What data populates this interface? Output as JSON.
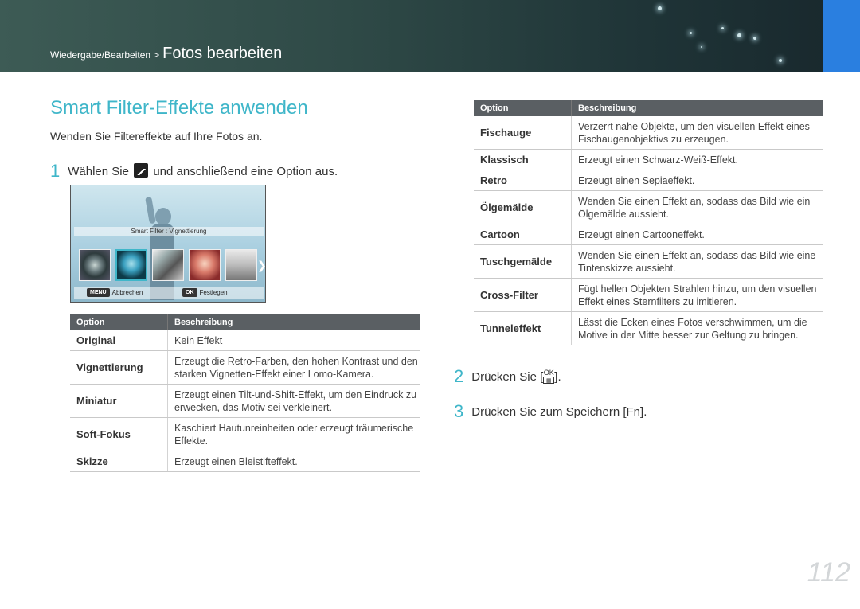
{
  "header": {
    "breadcrumb_parent": "Wiedergabe/Bearbeiten",
    "breadcrumb_separator": ">",
    "breadcrumb_current": "Fotos bearbeiten",
    "accent_color": "#3fb6c9",
    "tab_color": "#2a7fe0"
  },
  "section": {
    "title": "Smart Filter-Effekte anwenden",
    "intro": "Wenden Sie Filtereffekte auf Ihre Fotos an."
  },
  "steps": {
    "step1_num": "1",
    "step1_pre": "Wählen Sie",
    "step1_icon": "photo-filter-icon",
    "step1_post": "und anschließend eine Option aus.",
    "step2_num": "2",
    "step2_text": "Drücken Sie [",
    "step2_key_top": "OK",
    "step2_key_bottom": "",
    "step2_end": "].",
    "step3_num": "3",
    "step3_text": "Drücken Sie zum Speichern [",
    "step3_key": "Fn",
    "step3_end": "]."
  },
  "camera_screen": {
    "filter_label": "Smart Filter : Vignettierung",
    "menu_key": "MENU",
    "cancel_label": "Abbrechen",
    "ok_key": "OK",
    "confirm_label": "Festlegen"
  },
  "table_header": {
    "option": "Option",
    "description": "Beschreibung"
  },
  "left_table": [
    {
      "option": "Original",
      "description": "Kein Effekt"
    },
    {
      "option": "Vignettierung",
      "description": "Erzeugt die Retro-Farben, den hohen Kontrast und den starken Vignetten-Effekt einer Lomo-Kamera."
    },
    {
      "option": "Miniatur",
      "description": "Erzeugt einen Tilt-und-Shift-Effekt, um den Eindruck zu erwecken, das Motiv sei verkleinert."
    },
    {
      "option": "Soft-Fokus",
      "description": "Kaschiert Hautunreinheiten oder erzeugt träumerische Effekte."
    },
    {
      "option": "Skizze",
      "description": "Erzeugt einen Bleistifteffekt."
    }
  ],
  "right_table": [
    {
      "option": "Fischauge",
      "description": "Verzerrt nahe Objekte, um den visuellen Effekt eines Fischaugenobjektivs zu erzeugen."
    },
    {
      "option": "Klassisch",
      "description": "Erzeugt einen Schwarz-Weiß-Effekt."
    },
    {
      "option": "Retro",
      "description": "Erzeugt einen Sepiaeffekt."
    },
    {
      "option": "Ölgemälde",
      "description": "Wenden Sie einen Effekt an, sodass das Bild wie ein Ölgemälde aussieht."
    },
    {
      "option": "Cartoon",
      "description": "Erzeugt einen Cartooneffekt."
    },
    {
      "option": "Tuschgemälde",
      "description": "Wenden Sie einen Effekt an, sodass das Bild wie eine Tintenskizze aussieht."
    },
    {
      "option": "Cross-Filter",
      "description": "Fügt hellen Objekten Strahlen hinzu, um den visuellen Effekt eines Sternfilters zu imitieren."
    },
    {
      "option": "Tunneleffekt",
      "description": "Lässt die Ecken eines Fotos verschwimmen, um die Motive in der Mitte besser zur Geltung zu bringen."
    }
  ],
  "page_number": "112"
}
